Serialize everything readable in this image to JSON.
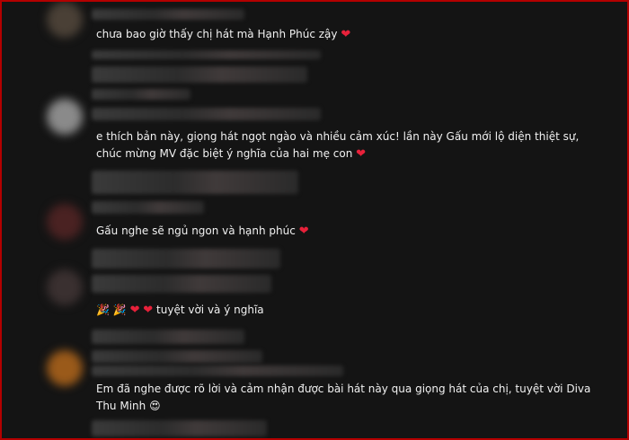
{
  "comments": [
    {
      "text": "chưa bao giờ thấy chị hát mà Hạnh Phúc zậy",
      "emoji": "❤"
    },
    {
      "text": "e thích bản này, giọng hát ngọt ngào và nhiều cảm xúc! lần này Gấu mới lộ diện thiệt sự, chúc mừng MV đặc biệt ý nghĩa của hai mẹ con",
      "emoji": "❤"
    },
    {
      "text": "Gấu nghe sẽ ngủ ngon và hạnh phúc",
      "emoji": "❤"
    },
    {
      "prefix_emoji": [
        "🎉",
        "🎉",
        "❤",
        "❤"
      ],
      "text": "tuyệt vời và ý nghĩa"
    },
    {
      "text": "Em đã nghe được rõ lời và cảm nhận được bài hát này qua giọng hát của chị, tuyệt vời Diva Thu Minh",
      "emoji": "😍"
    }
  ],
  "colors": {
    "border": "#b30000",
    "background": "#141414",
    "text": "#f1f1f1",
    "heart": "#e8213a"
  }
}
